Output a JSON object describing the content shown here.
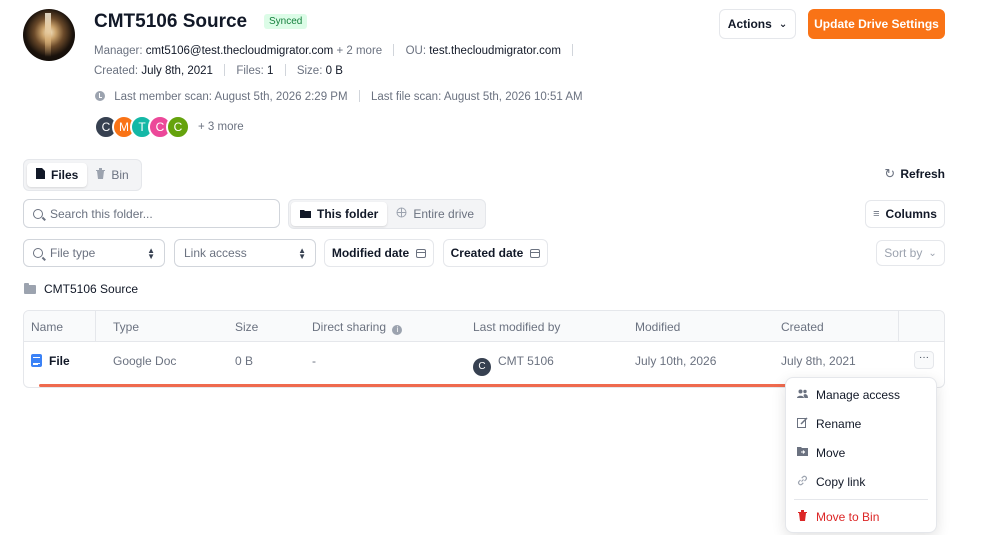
{
  "header": {
    "title": "CMT5106 Source",
    "status_badge": "Synced",
    "manager_label": "Manager:",
    "manager_value": "cmt5106@test.thecloudmigrator.com",
    "manager_more": "+ 2 more",
    "ou_label": "OU:",
    "ou_value": "test.thecloudmigrator.com",
    "created_label": "Created:",
    "created_value": "July 8th, 2021",
    "files_label": "Files:",
    "files_value": "1",
    "size_label": "Size:",
    "size_value": "0 B",
    "last_member_scan": "Last member scan: August 5th, 2026 2:29 PM",
    "last_file_scan": "Last file scan: August 5th, 2026 10:51 AM",
    "member_initials": [
      "C",
      "M",
      "T",
      "C",
      "C"
    ],
    "member_colors": [
      "#374151",
      "#f97316",
      "#14b8a6",
      "#ec4899",
      "#65a30d"
    ],
    "members_more": "+ 3 more",
    "actions_label": "Actions",
    "update_label": "Update Drive Settings"
  },
  "tabs": {
    "files": "Files",
    "bin": "Bin"
  },
  "toolbar": {
    "refresh": "Refresh",
    "search_placeholder": "Search this folder...",
    "this_folder": "This folder",
    "entire_drive": "Entire drive",
    "columns": "Columns",
    "file_type_placeholder": "File type",
    "link_access_placeholder": "Link access",
    "modified_date": "Modified date",
    "created_date": "Created date",
    "sort_by": "Sort by"
  },
  "breadcrumb": "CMT5106 Source",
  "table": {
    "columns": [
      "Name",
      "Type",
      "Size",
      "Direct sharing",
      "Last modified by",
      "Modified",
      "Created"
    ],
    "rows": [
      {
        "name": "File",
        "type": "Google Doc",
        "size": "0 B",
        "sharing": "-",
        "modified_by_initial": "C",
        "modified_by": "CMT 5106",
        "modified": "July 10th, 2026",
        "created": "July 8th, 2021"
      }
    ]
  },
  "context_menu": {
    "items": [
      "Manage access",
      "Rename",
      "Move",
      "Copy link"
    ],
    "danger_item": "Move to Bin"
  },
  "colors": {
    "accent": "#f97316",
    "synced_bg": "#dcfce7",
    "synced_text": "#15803d",
    "danger": "#dc2626"
  }
}
